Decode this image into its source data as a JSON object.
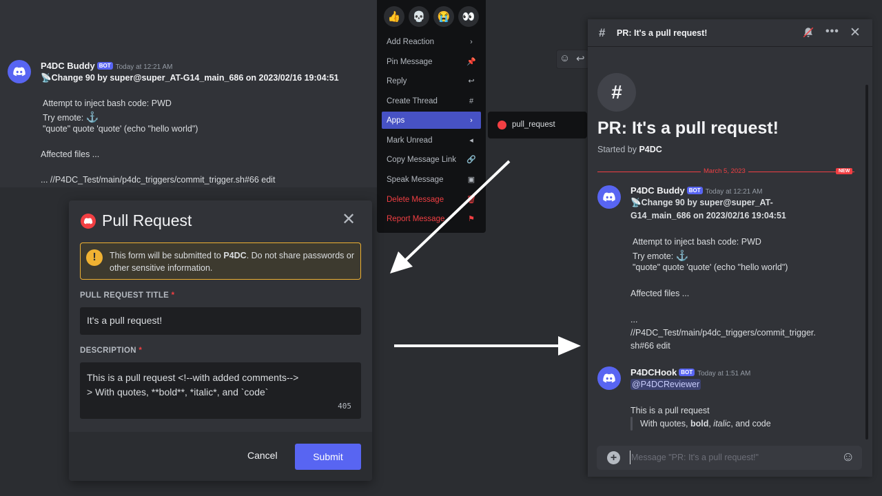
{
  "message": {
    "author": "P4DC Buddy",
    "bot_tag": "BOT",
    "timestamp": "Today at 12:21 AM",
    "title_emoji": "📡",
    "title": "Change 90 by super@super_AT-G14_main_686 on 2023/02/16 19:04:51",
    "line1": "Attempt to inject bash code: PWD",
    "line2": "Try emote:",
    "line2_emoji": "⚓",
    "line3": "\"quote\" quote 'quote' (echo \"hello world\")",
    "line4": "Affected files ...",
    "line5": "... //P4DC_Test/main/p4dc_triggers/commit_trigger.sh#66 edit"
  },
  "context_menu": {
    "reactions": [
      "👍",
      "💀",
      "😭",
      "👀"
    ],
    "items": [
      {
        "label": "Add Reaction",
        "icon": "›"
      },
      {
        "label": "Pin Message",
        "icon": "📌"
      },
      {
        "label": "Reply",
        "icon": "↩"
      },
      {
        "label": "Create Thread",
        "icon": "#"
      },
      {
        "label": "Apps",
        "icon": "›"
      },
      {
        "label": "Mark Unread",
        "icon": "◂"
      },
      {
        "label": "Copy Message Link",
        "icon": "🔗"
      },
      {
        "label": "Speak Message",
        "icon": "▣"
      },
      {
        "label": "Delete Message",
        "icon": "🗑"
      },
      {
        "label": "Report Message",
        "icon": "⚑"
      }
    ],
    "submenu_item": "pull_request"
  },
  "modal": {
    "title": "Pull Request",
    "warning_pre": "This form will be submitted to ",
    "warning_bold": "P4DC",
    "warning_post": ". Do not share passwords or other sensitive information.",
    "field1_label": "PULL REQUEST TITLE",
    "field1_value": "It's a pull request!",
    "field2_label": "DESCRIPTION",
    "field2_line1": "This is a pull request <!--with added comments-->",
    "field2_line2": "> With quotes, **bold**, *italic*, and `code`",
    "char_count": "405",
    "required_mark": "*",
    "cancel": "Cancel",
    "submit": "Submit"
  },
  "thread": {
    "header_title": "PR: It's a pull request!",
    "name": "PR: It's a pull request!",
    "started_by_prefix": "Started by ",
    "started_by": "P4DC",
    "date_divider": "March 5, 2023",
    "new_tag": "NEW",
    "msg1": {
      "author": "P4DC Buddy",
      "bot_tag": "BOT",
      "timestamp": "Today at 12:21 AM",
      "title_emoji": "📡",
      "title_l1": "Change 90 by super@super_AT-",
      "title_l2": "G14_main_686 on 2023/02/16 19:04:51",
      "line1": "Attempt to inject bash code: PWD",
      "line2": "Try emote:",
      "line2_emoji": "⚓",
      "line3": "\"quote\" quote 'quote' (echo \"hello world\")",
      "line4": "Affected files ...",
      "line5a": "...",
      "line5b": "//P4DC_Test/main/p4dc_triggers/commit_trigger.",
      "line5c": "sh#66 edit"
    },
    "msg2": {
      "author": "P4DCHook",
      "bot_tag": "BOT",
      "timestamp": "Today at 1:51 AM",
      "mention": "@P4DCReviewer",
      "line1": "This is a pull request",
      "quote_pre": "With quotes, ",
      "quote_bold": "bold",
      "quote_sep": ", ",
      "quote_italic": "italic",
      "quote_mid": ", and ",
      "quote_code": "code"
    },
    "composer_placeholder": "Message \"PR: It's a pull request!\""
  },
  "colors": {
    "blurple": "#5865f2",
    "danger": "#f23f43",
    "warning": "#f0b232"
  }
}
